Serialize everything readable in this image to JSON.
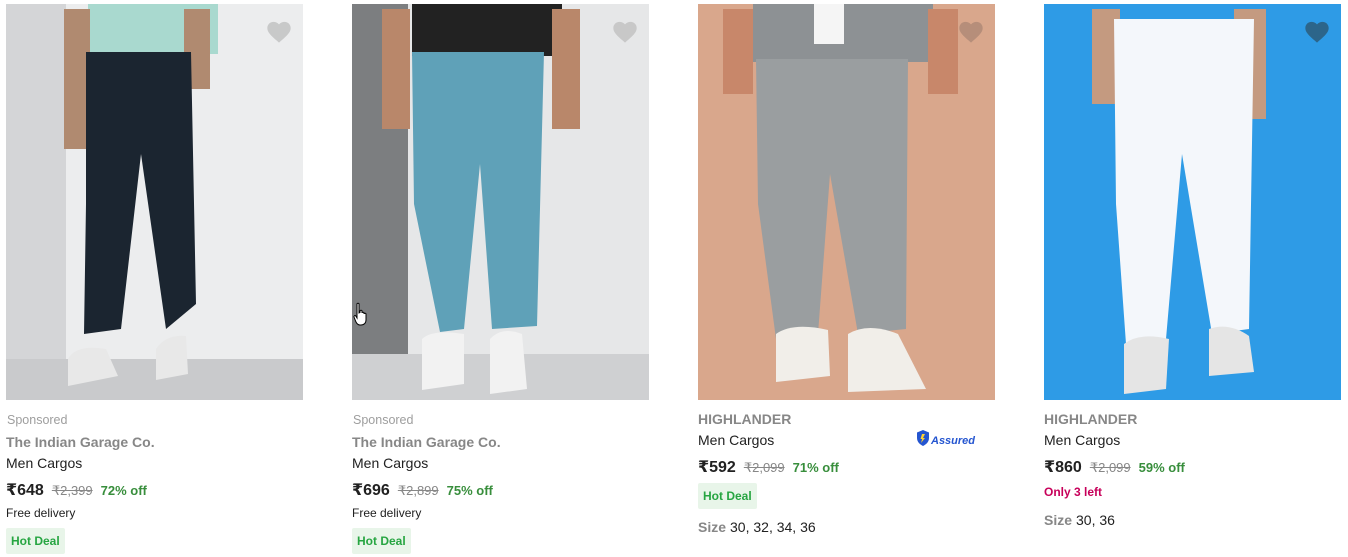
{
  "products": [
    {
      "sponsored": "Sponsored",
      "brand": "The Indian Garage Co.",
      "title": "Men Cargos",
      "price": "₹648",
      "mrp": "₹2,399",
      "discount": "72% off",
      "delivery": "Free delivery",
      "deal": "Hot Deal",
      "image_colors": {
        "bg": "#ecedee",
        "pant": "#1b2530",
        "shirt": "#a9d9cf"
      }
    },
    {
      "sponsored": "Sponsored",
      "brand": "The Indian Garage Co.",
      "title": "Men Cargos",
      "price": "₹696",
      "mrp": "₹2,899",
      "discount": "75% off",
      "delivery": "Free delivery",
      "deal": "Hot Deal",
      "image_colors": {
        "bg": "#e6e7e8",
        "pant": "#5fa1b8",
        "shirt": "#222222"
      }
    },
    {
      "brand": "HIGHLANDER",
      "title": "Men Cargos",
      "assured": "Assured",
      "price": "₹592",
      "mrp": "₹2,099",
      "discount": "71% off",
      "deal": "Hot Deal",
      "size_label": "Size",
      "sizes": "30, 32, 34, 36",
      "image_colors": {
        "bg": "#d9a78c",
        "pant": "#9a9ea0",
        "shirt": "#8d9194"
      }
    },
    {
      "brand": "HIGHLANDER",
      "title": "Men Cargos",
      "price": "₹860",
      "mrp": "₹2,099",
      "discount": "59% off",
      "stock_note": "Only 3 left",
      "size_label": "Size",
      "sizes": "30, 36",
      "image_colors": {
        "bg": "#2e9be6",
        "pant": "#f4f7fb",
        "shirt": "#2e9be6"
      }
    }
  ],
  "icons": {
    "wishlist": "heart-icon",
    "assured": "shield-check-icon",
    "cursor": "hand-pointer-icon"
  },
  "colors": {
    "discount": "#388e3c",
    "hot_deal_bg": "#e8f5e9",
    "hot_deal_text": "#26a541",
    "stock_note": "#c7005a",
    "assured": "#2455d0"
  }
}
